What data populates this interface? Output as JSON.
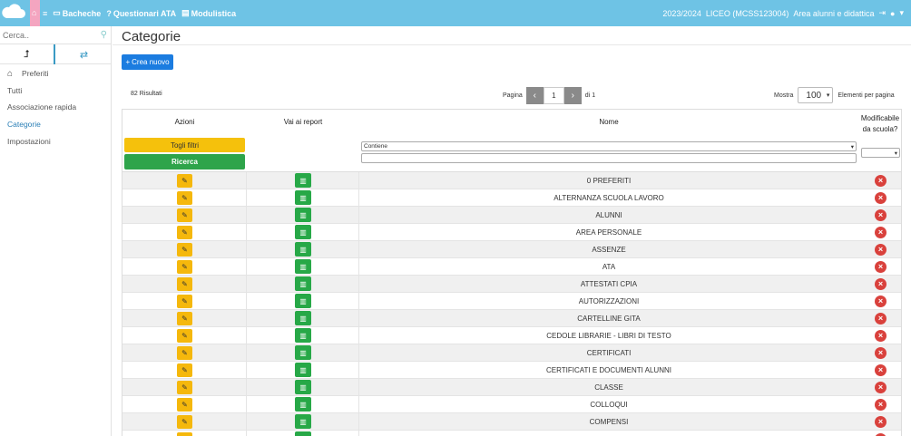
{
  "topbar": {
    "logo_icon": "cloud-icon",
    "home_icon": "home-icon",
    "nav": [
      {
        "icon": "menu-icon",
        "label": ""
      },
      {
        "icon": "board-icon",
        "label": "Bacheche"
      },
      {
        "icon": "question-icon",
        "label": "Questionari ATA"
      },
      {
        "icon": "doc-icon",
        "label": "Modulistica"
      }
    ],
    "year": "2023/2024",
    "school": "LICEO (MCSS123004)",
    "area": "Area alunni e didattica"
  },
  "sidebar": {
    "search_placeholder": "Cerca..",
    "items": [
      {
        "label": "Preferiti",
        "icon": "home-icon"
      },
      {
        "label": "Tutti"
      },
      {
        "label": "Associazione rapida"
      },
      {
        "label": "Categorie",
        "active": true
      },
      {
        "label": "Impostazioni"
      }
    ]
  },
  "main": {
    "title": "Categorie",
    "new_button": "Crea nuovo",
    "results": "82 Risultati",
    "pager": {
      "label": "Pagina",
      "current": "1",
      "of": "di 1"
    },
    "show": {
      "label": "Mostra",
      "value": "100",
      "suffix": "Elementi per pagina"
    }
  },
  "table": {
    "headers": {
      "actions": "Azioni",
      "report": "Vai ai report",
      "name": "Nome",
      "editable_line1": "Modificabile",
      "editable_line2": "da scuola?"
    },
    "filter_button": "Togli filtri",
    "search_button": "Ricerca",
    "name_filter": "Contiene",
    "rows": [
      "0 PREFERITI",
      "ALTERNANZA SCUOLA LAVORO",
      "ALUNNI",
      "AREA PERSONALE",
      "ASSENZE",
      "ATA",
      "ATTESTATI CPIA",
      "AUTORIZZAZIONI",
      "CARTELLINE GITA",
      "CEDOLE LIBRARIE - LIBRI DI TESTO",
      "CERTIFICATI",
      "CERTIFICATI E DOCUMENTI ALUNNI",
      "CLASSE",
      "COLLOQUI",
      "COMPENSI",
      ""
    ]
  },
  "colors": {
    "topbar": "#6ec3e5",
    "primary": "#1b7ce0",
    "warning": "#f5c10c",
    "success": "#2ea44a",
    "danger": "#d9413c"
  }
}
